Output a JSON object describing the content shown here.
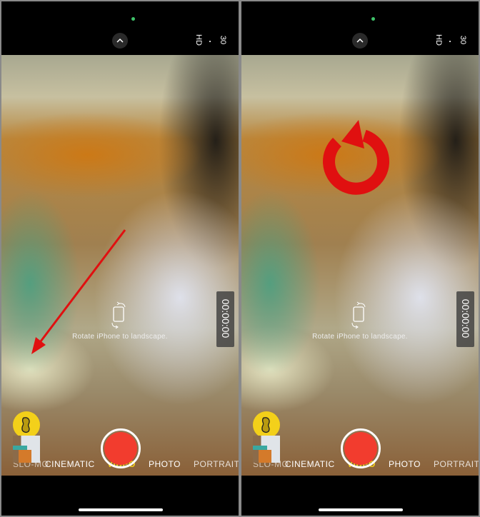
{
  "camera": {
    "resolution": "HD",
    "fps": "30",
    "timer": "00:00:00",
    "rotate_hint": "Rotate iPhone to landscape.",
    "modes": [
      "SLO-MO",
      "CINEMATIC",
      "VIDEO",
      "PHOTO",
      "PORTRAIT"
    ],
    "selected_mode": "VIDEO"
  },
  "colors": {
    "annotation": "#e01010",
    "record": "#f23c2e",
    "mode_active": "#f5d21e",
    "indicator": "#3fc36a"
  },
  "annotations": {
    "left_panel": "arrow-pointing-to-bean-button",
    "right_panel": "rotate-icon"
  }
}
